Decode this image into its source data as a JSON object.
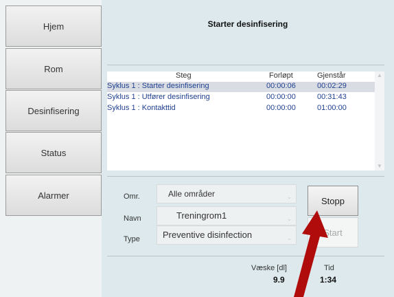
{
  "nav": {
    "items": [
      {
        "label": "Hjem"
      },
      {
        "label": "Rom"
      },
      {
        "label": "Desinfisering"
      },
      {
        "label": "Status"
      },
      {
        "label": "Alarmer"
      }
    ]
  },
  "title": "Starter desinfisering",
  "table": {
    "headers": {
      "step": "Steg",
      "elapsed": "Forløpt",
      "remaining": "Gjenstår"
    },
    "rows": [
      {
        "step": "Syklus 1 : Starter desinfisering",
        "elapsed": "00:00:06",
        "remaining": "00:02:29",
        "selected": true
      },
      {
        "step": "Syklus 1 : Utfører desinfisering",
        "elapsed": "00:00:00",
        "remaining": "00:31:43",
        "selected": false
      },
      {
        "step": "Syklus 1 : Kontakttid",
        "elapsed": "00:00:00",
        "remaining": "01:00:00",
        "selected": false
      }
    ]
  },
  "form": {
    "area_label": "Omr.",
    "area_value": "Alle områder",
    "name_label": "Navn",
    "name_value": "Treningrom1",
    "type_label": "Type",
    "type_value": "Preventive disinfection"
  },
  "buttons": {
    "stop": "Stopp",
    "start": "Start"
  },
  "stats": {
    "liquid_label": "Væske [dl]",
    "liquid_value": "9.9",
    "time_label": "Tid",
    "time_value": "1:34"
  },
  "colors": {
    "accent_arrow": "#b00c0c",
    "table_text": "#1f3f8f"
  }
}
